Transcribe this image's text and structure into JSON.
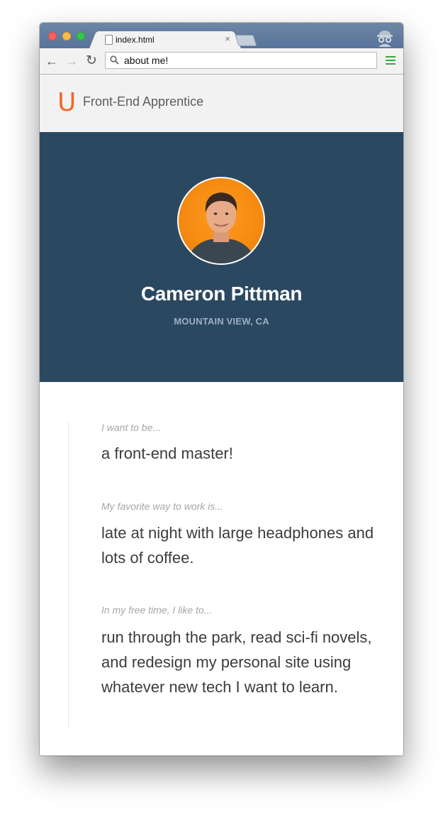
{
  "browser": {
    "tab_title": "index.html",
    "tab_close": "×",
    "address": "about me!",
    "icons": {
      "back": "back-arrow-icon",
      "forward": "forward-arrow-icon",
      "reload": "reload-icon",
      "search": "search-icon",
      "menu": "hamburger-menu-icon",
      "incognito": "incognito-icon",
      "page": "document-icon"
    },
    "glyphs": {
      "back": "←",
      "forward": "→",
      "reload": "↻"
    }
  },
  "site": {
    "logo_letter": "U",
    "title": "Front-End Apprentice"
  },
  "profile": {
    "name": "Cameron Pittman",
    "location": "MOUNTAIN VIEW, CA"
  },
  "qa": [
    {
      "question": "I want to be...",
      "answer": "a front-end master!"
    },
    {
      "question": "My favorite way to work is...",
      "answer": "late at night with large headphones and lots of coffee."
    },
    {
      "question": "In my free time, I like to...",
      "answer": "run through the park, read sci-fi novels, and redesign my personal site using whatever new tech I want to learn."
    }
  ],
  "colors": {
    "brand": "#f26722",
    "hero_bg": "#2b4861",
    "header_bg": "#f2f2f2",
    "location_text": "#9bb0c3"
  }
}
